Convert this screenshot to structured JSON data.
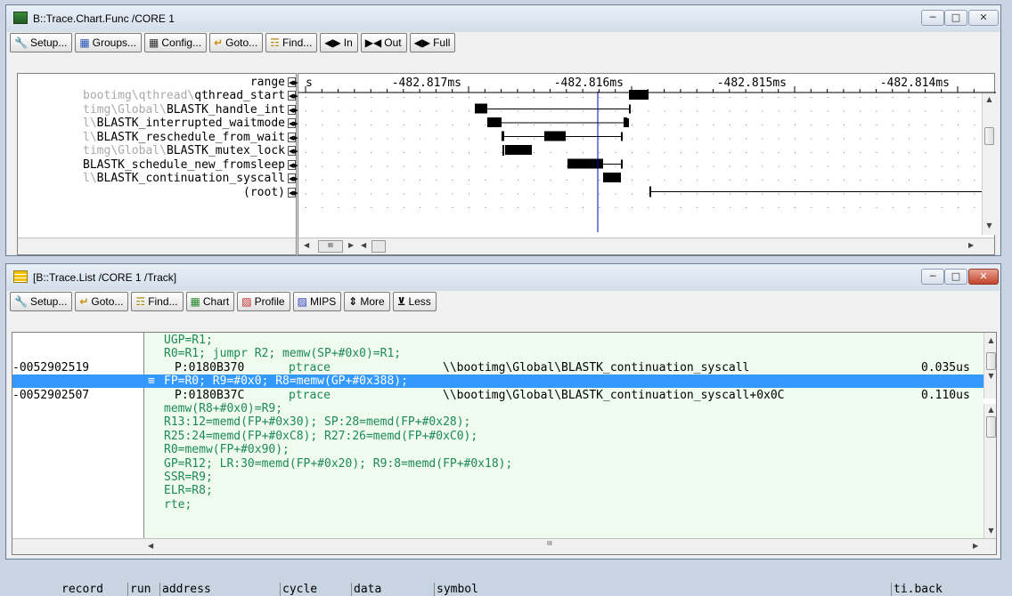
{
  "chart_window": {
    "title": "B::Trace.Chart.Func /CORE 1",
    "toolbar": [
      {
        "icon": "wrench-icon",
        "label": "Setup..."
      },
      {
        "icon": "groups-icon",
        "label": "Groups..."
      },
      {
        "icon": "config-icon",
        "label": "Config..."
      },
      {
        "icon": "goto-icon",
        "label": "Goto..."
      },
      {
        "icon": "binoculars-icon",
        "label": "Find..."
      },
      {
        "icon": "zoom-in-icon",
        "label": "In"
      },
      {
        "icon": "zoom-out-icon",
        "label": "Out"
      },
      {
        "icon": "zoom-full-icon",
        "label": "Full"
      }
    ],
    "range_label": "range",
    "time_axis": {
      "unit_label": "s",
      "ticks": [
        "-482.817ms",
        "-482.816ms",
        "-482.815ms",
        "-482.814ms"
      ]
    },
    "functions": [
      {
        "prefix": "bootimg\\qthread\\",
        "name": "qthread_start"
      },
      {
        "prefix": "timg\\Global\\",
        "name": "BLASTK_handle_int"
      },
      {
        "prefix": "l\\",
        "name": "BLASTK_interrupted_waitmode"
      },
      {
        "prefix": "l\\",
        "name": "BLASTK_reschedule_from_wait"
      },
      {
        "prefix": "timg\\Global\\",
        "name": "BLASTK_mutex_lock"
      },
      {
        "prefix": "",
        "name": "BLASTK_schedule_new_fromsleep"
      },
      {
        "prefix": "l\\",
        "name": "BLASTK_continuation_syscall"
      },
      {
        "prefix": "",
        "name": "(root)"
      }
    ],
    "hscroll_thumb_glyph": "III"
  },
  "list_window": {
    "title": "[B::Trace.List /CORE 1 /Track]",
    "toolbar": [
      {
        "icon": "wrench-icon",
        "label": "Setup..."
      },
      {
        "icon": "goto-icon",
        "label": "Goto..."
      },
      {
        "icon": "binoculars-icon",
        "label": "Find..."
      },
      {
        "icon": "chart-icon",
        "label": "Chart"
      },
      {
        "icon": "profile-icon",
        "label": "Profile"
      },
      {
        "icon": "mips-icon",
        "label": "MIPS"
      },
      {
        "icon": "more-icon",
        "label": "More"
      },
      {
        "icon": "less-icon",
        "label": "Less"
      }
    ],
    "columns": [
      "record",
      "run",
      "address",
      "cycle",
      "data",
      "symbol",
      "ti.back"
    ],
    "rows": [
      {
        "kind": "asm",
        "text": "UGP=R1;"
      },
      {
        "kind": "asm",
        "text": "R0=R1; jumpr R2; memw(SP+#0x0)=R1;"
      },
      {
        "kind": "rec",
        "record": "-0052902519",
        "address": "P:0180B370",
        "cycle": "ptrace",
        "symbol": "\\\\bootimg\\Global\\BLASTK_continuation_syscall",
        "tiback": "0.035us"
      },
      {
        "kind": "sel",
        "text": "FP=R0; R9=#0x0; R8=memw(GP+#0x388);"
      },
      {
        "kind": "rec",
        "record": "-0052902507",
        "address": "P:0180B37C",
        "cycle": "ptrace",
        "symbol": "\\\\bootimg\\Global\\BLASTK_continuation_syscall+0x0C",
        "tiback": "0.110us"
      },
      {
        "kind": "asm",
        "text": "memw(R8+#0x0)=R9;"
      },
      {
        "kind": "asm",
        "text": "R13:12=memd(FP+#0x30); SP:28=memd(FP+#0x28);"
      },
      {
        "kind": "asm",
        "text": "R25:24=memd(FP+#0xC8); R27:26=memd(FP+#0xC0);"
      },
      {
        "kind": "asm",
        "text": "R0=memw(FP+#0x90);"
      },
      {
        "kind": "asm",
        "text": "GP=R12; LR:30=memd(FP+#0x20); R9:8=memd(FP+#0x18);"
      },
      {
        "kind": "asm",
        "text": "SSR=R9;"
      },
      {
        "kind": "asm",
        "text": "ELR=R8;"
      },
      {
        "kind": "asm",
        "text": "rte;"
      }
    ],
    "hscroll_thumb_glyph": "III"
  },
  "colors": {
    "accent_blue": "#3399ff",
    "asm_green": "#1e8a55",
    "trace_bg": "#eefbee",
    "cursor_line": "#0000c0"
  }
}
